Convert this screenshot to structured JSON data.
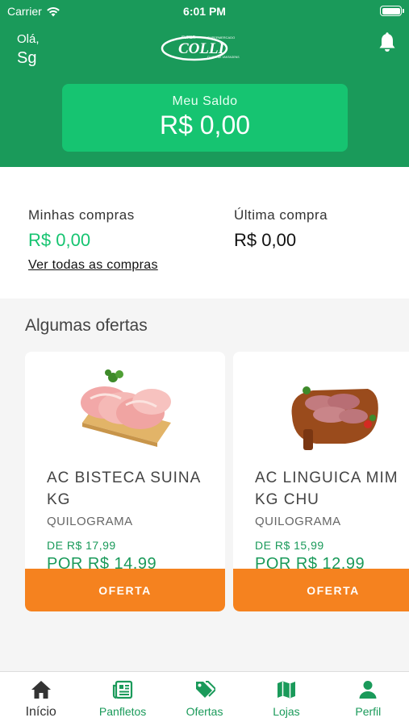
{
  "status_bar": {
    "carrier": "Carrier",
    "time": "6:01 PM"
  },
  "header": {
    "greeting": "Olá,",
    "user_name": "Sg",
    "logo_text": "COLLI",
    "logo_top": "SUPER",
    "logo_sub": "CLUBE DE VANTAGENS",
    "balance_label": "Meu Saldo",
    "balance_value": "R$ 0,00"
  },
  "summary": {
    "my_purchases_label": "Minhas compras",
    "my_purchases_value": "R$ 0,00",
    "last_purchase_label": "Última compra",
    "last_purchase_value": "R$ 0,00",
    "see_all_link": "Ver todas as compras"
  },
  "offers": {
    "title": "Algumas ofertas",
    "items": [
      {
        "name": "AC BISTECA SUINA KG",
        "unit": "QUILOGRAMA",
        "old_price": "DE R$ 17,99",
        "new_price": "POR R$ 14,99",
        "button": "OFERTA"
      },
      {
        "name": "AC LINGUICA MIM KG CHU",
        "unit": "QUILOGRAMA",
        "old_price": "DE R$ 15,99",
        "new_price": "POR R$ 12,99",
        "button": "OFERTA"
      }
    ]
  },
  "tab_bar": {
    "items": [
      {
        "label": "Início",
        "icon": "home-icon",
        "active": true
      },
      {
        "label": "Panfletos",
        "icon": "newspaper-icon",
        "active": false
      },
      {
        "label": "Ofertas",
        "icon": "tags-icon",
        "active": false
      },
      {
        "label": "Lojas",
        "icon": "map-icon",
        "active": false
      },
      {
        "label": "Perfil",
        "icon": "user-icon",
        "active": false
      }
    ]
  },
  "colors": {
    "header_green": "#1a9a5a",
    "balance_green": "#16c471",
    "offer_orange": "#f5821f"
  }
}
